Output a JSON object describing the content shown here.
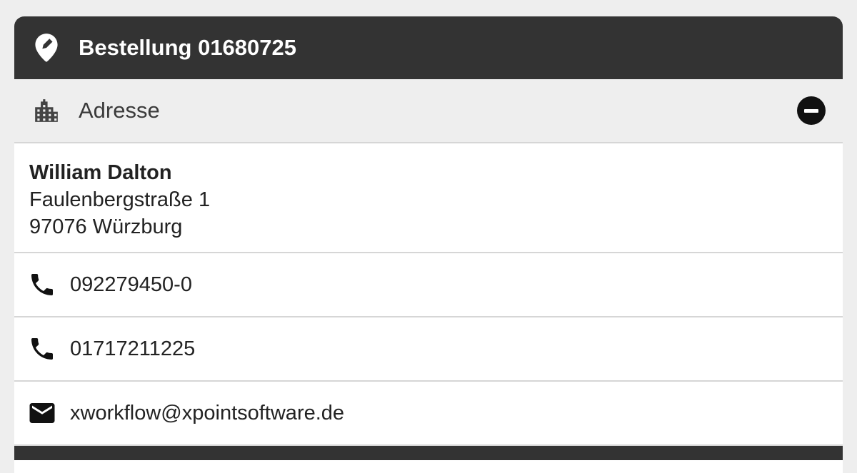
{
  "header": {
    "icon": "location-pin-icon",
    "title": "Bestellung 01680725"
  },
  "section": {
    "icon": "building-icon",
    "title": "Adresse",
    "collapse_icon": "minus-circle-icon"
  },
  "address": {
    "name": "William Dalton",
    "street": "Faulenbergstraße 1",
    "city": "97076 Würzburg"
  },
  "contacts": [
    {
      "icon": "phone-icon",
      "value": "092279450-0"
    },
    {
      "icon": "phone-icon",
      "value": "01717211225"
    },
    {
      "icon": "mail-icon",
      "value": "xworkflow@xpointsoftware.de"
    }
  ],
  "colors": {
    "header_bg": "#333333",
    "section_bg": "#eeeeee",
    "divider": "#d6d6d6",
    "text": "#222222"
  }
}
